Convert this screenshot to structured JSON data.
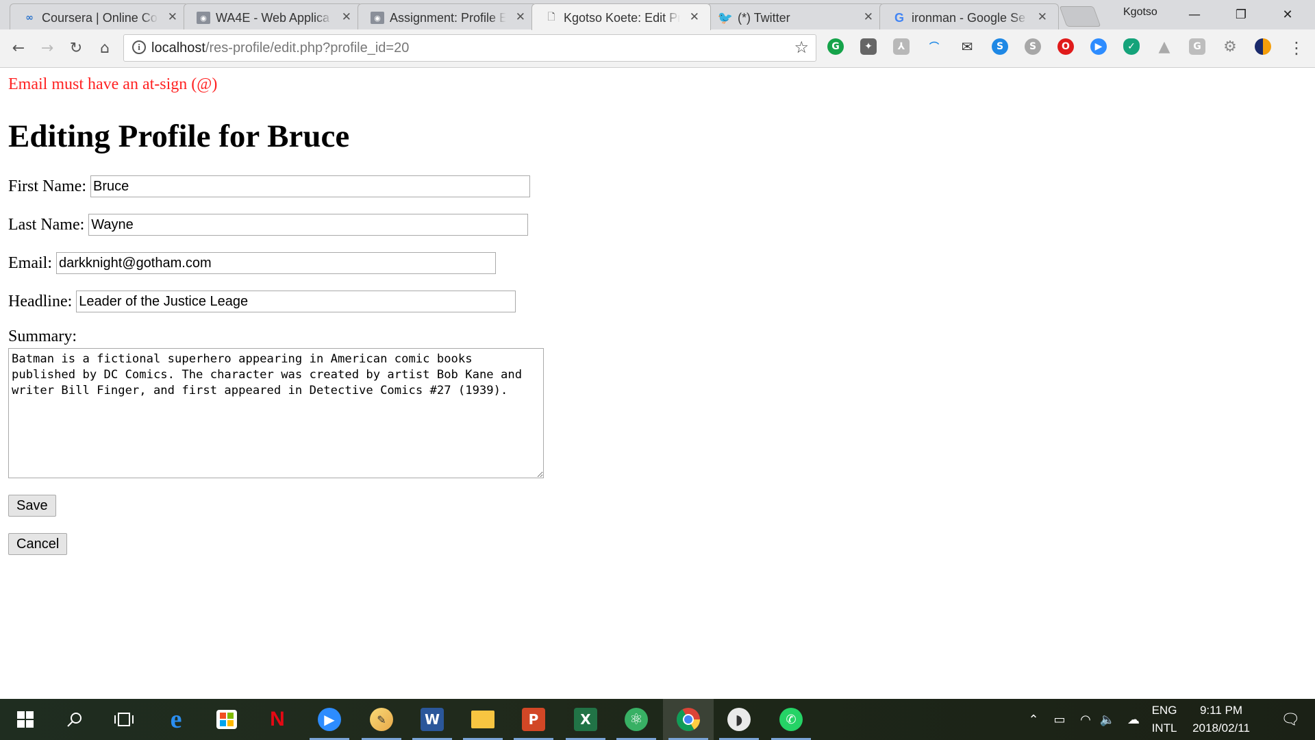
{
  "browser": {
    "tabs": [
      {
        "title": "Coursera | Online Co",
        "icon": "coursera-icon"
      },
      {
        "title": "WA4E - Web Applica",
        "icon": "wa4e-icon"
      },
      {
        "title": "Assignment: Profile E",
        "icon": "wa4e-icon"
      },
      {
        "title": "Kgotso Koete: Edit Pr",
        "icon": "page-icon"
      },
      {
        "title": "(*) Twitter",
        "icon": "twitter-icon"
      },
      {
        "title": "ironman - Google Se",
        "icon": "google-icon"
      }
    ],
    "active_tab": 3,
    "profile_name": "Kgotso",
    "url_host": "localhost",
    "url_path": "/res-profile/edit.php?profile_id=20"
  },
  "page": {
    "error_message": "Email must have an at-sign (@)",
    "heading": "Editing Profile for Bruce",
    "fields": {
      "first_name": {
        "label": "First Name:",
        "value": "Bruce"
      },
      "last_name": {
        "label": "Last Name:",
        "value": "Wayne"
      },
      "email": {
        "label": "Email:",
        "value": "darkknight@gotham.com"
      },
      "headline": {
        "label": "Headline:",
        "value": "Leader of the Justice Leage"
      }
    },
    "summary": {
      "label": "Summary:",
      "value": "Batman is a fictional superhero appearing in American comic books published by DC Comics. The character was created by artist Bob Kane and writer Bill Finger, and first appeared in Detective Comics #27 (1939)."
    },
    "save_label": "Save",
    "cancel_label": "Cancel"
  },
  "taskbar": {
    "lang_top": "ENG",
    "lang_bottom": "INTL",
    "time": "9:11 PM",
    "date": "2018/02/11"
  },
  "colors": {
    "error": "#ff2222",
    "tab_strip": "#dadbde",
    "toolbar": "#f2f2f2"
  }
}
